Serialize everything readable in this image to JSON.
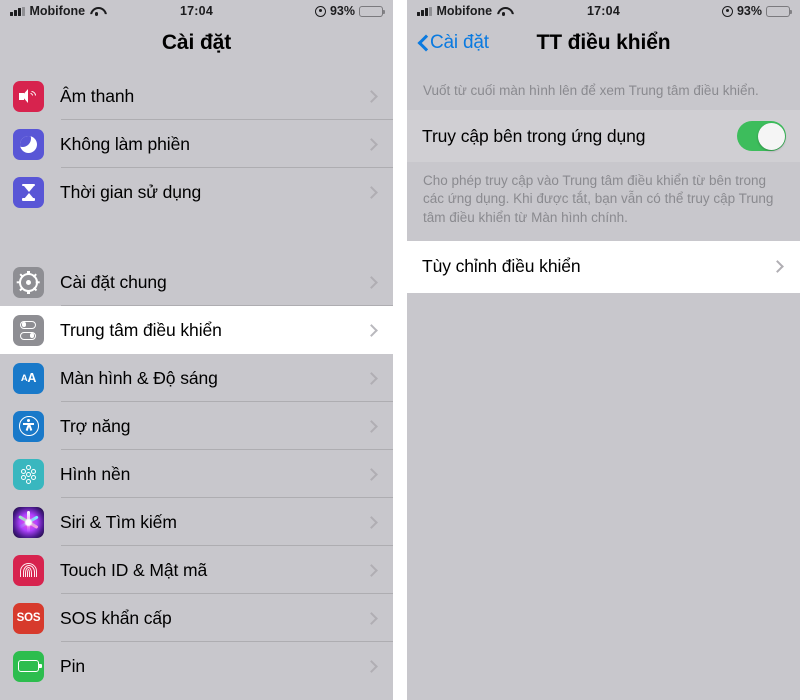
{
  "status_bar": {
    "carrier": "Mobifone",
    "time": "17:04",
    "battery_percent": "93%",
    "signal_icon": "signal-bars-icon",
    "wifi_icon": "wifi-icon",
    "orientation_lock_icon": "orientation-lock-icon",
    "battery_icon": "battery-icon"
  },
  "colors": {
    "background": "#c8c7cc",
    "row_background": "#c8c7cc",
    "selected_row": "#ffffff",
    "accent_blue": "#0a7ae0",
    "toggle_on": "#3dbd5c",
    "footnote_text": "#8a8a8f",
    "separator": "rgba(0,0,0,0.13)"
  },
  "left_screen": {
    "nav": {
      "title": "Cài đặt"
    },
    "groups": [
      {
        "items": [
          {
            "label": "Âm thanh",
            "icon": "speaker-icon",
            "icon_color": "#d7234e",
            "selected": false
          },
          {
            "label": "Không làm phiền",
            "icon": "moon-icon",
            "icon_color": "#5956d6",
            "selected": false
          },
          {
            "label": "Thời gian sử dụng",
            "icon": "hourglass-icon",
            "icon_color": "#5956d6",
            "selected": false
          }
        ]
      },
      {
        "items": [
          {
            "label": "Cài đặt chung",
            "icon": "gear-icon",
            "icon_color": "#8e8e93",
            "selected": false
          },
          {
            "label": "Trung tâm điều khiển",
            "icon": "control-center-icon",
            "icon_color": "#8e8e93",
            "selected": true
          },
          {
            "label": "Màn hình & Độ sáng",
            "icon": "display-brightness-icon",
            "icon_color": "#1979c9",
            "selected": false
          },
          {
            "label": "Trợ năng",
            "icon": "accessibility-icon",
            "icon_color": "#1979c9",
            "selected": false
          },
          {
            "label": "Hình nền",
            "icon": "wallpaper-icon",
            "icon_color": "#39b7bf",
            "selected": false
          },
          {
            "label": "Siri & Tìm kiếm",
            "icon": "siri-icon",
            "icon_color": "#2b1a4d",
            "selected": false
          },
          {
            "label": "Touch ID & Mật mã",
            "icon": "touch-id-icon",
            "icon_color": "#d7234e",
            "selected": false
          },
          {
            "label": "SOS khẩn cấp",
            "icon": "sos-icon",
            "icon_color": "#d73a2c",
            "selected": false
          },
          {
            "label": "Pin",
            "icon": "battery-icon",
            "icon_color": "#2dbd4e",
            "selected": false
          }
        ]
      }
    ]
  },
  "right_screen": {
    "nav": {
      "back_label": "Cài đặt",
      "back_icon": "chevron-left-icon",
      "title": "TT điều khiển"
    },
    "header_footnote": "Vuốt từ cuối màn hình lên để xem Trung tâm điều khiển.",
    "toggle_row": {
      "label": "Truy cập bên trong ứng dụng",
      "toggle_state": "on"
    },
    "toggle_footnote": "Cho phép truy cập vào Trung tâm điều khiển từ bên trong các ứng dụng. Khi được tắt, bạn vẫn có thể truy cập Trung tâm điều khiển từ Màn hình chính.",
    "customize_row": {
      "label": "Tùy chỉnh điều khiển",
      "chevron_icon": "chevron-right-icon"
    }
  }
}
